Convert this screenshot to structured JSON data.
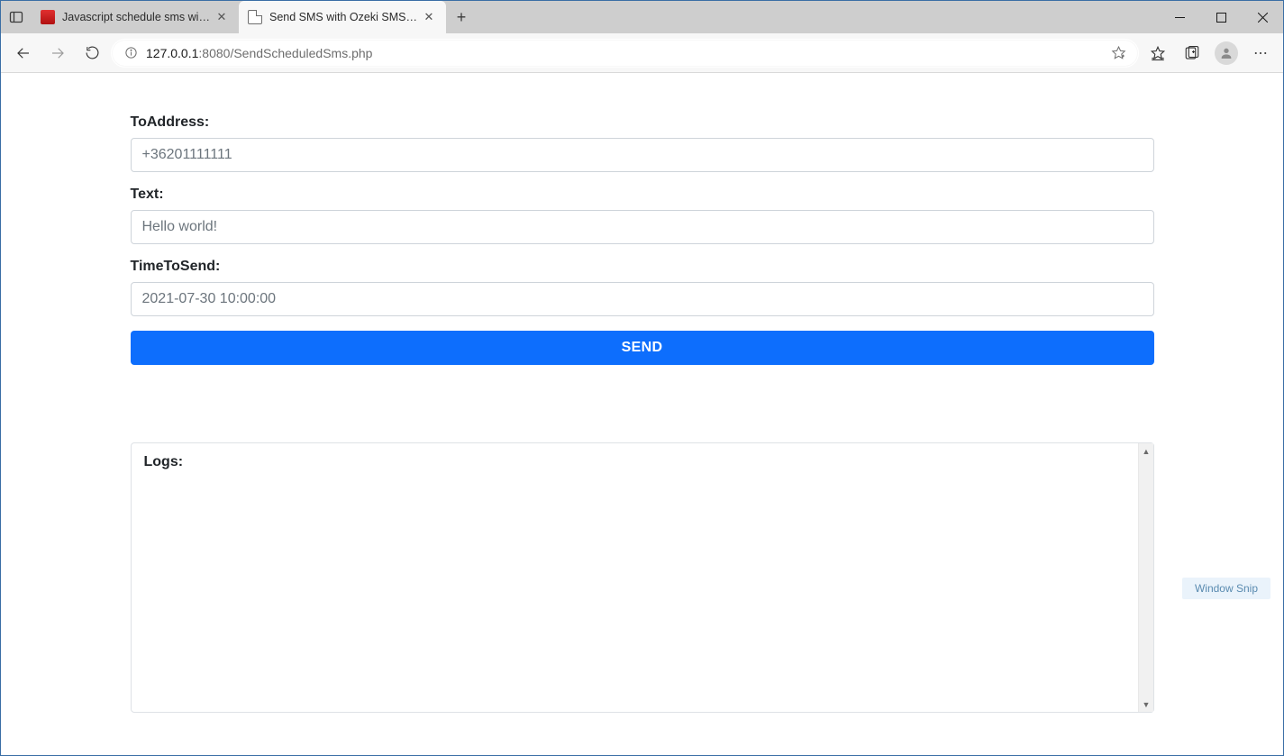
{
  "browser": {
    "tabs": [
      {
        "label": "Javascript schedule sms with the http rest api (code sample)",
        "active": false
      },
      {
        "label": "Send SMS with Ozeki SMS Gateway",
        "active": true
      }
    ],
    "url_host": "127.0.0.1",
    "url_port": ":8080",
    "url_path": "/SendScheduledSms.php"
  },
  "form": {
    "to_label": "ToAddress:",
    "to_placeholder": "+36201111111",
    "text_label": "Text:",
    "text_placeholder": "Hello world!",
    "time_label": "TimeToSend:",
    "time_placeholder": "2021-07-30 10:00:00",
    "send_label": "SEND"
  },
  "logs": {
    "title": "Logs:"
  },
  "watermark": "Window Snip"
}
